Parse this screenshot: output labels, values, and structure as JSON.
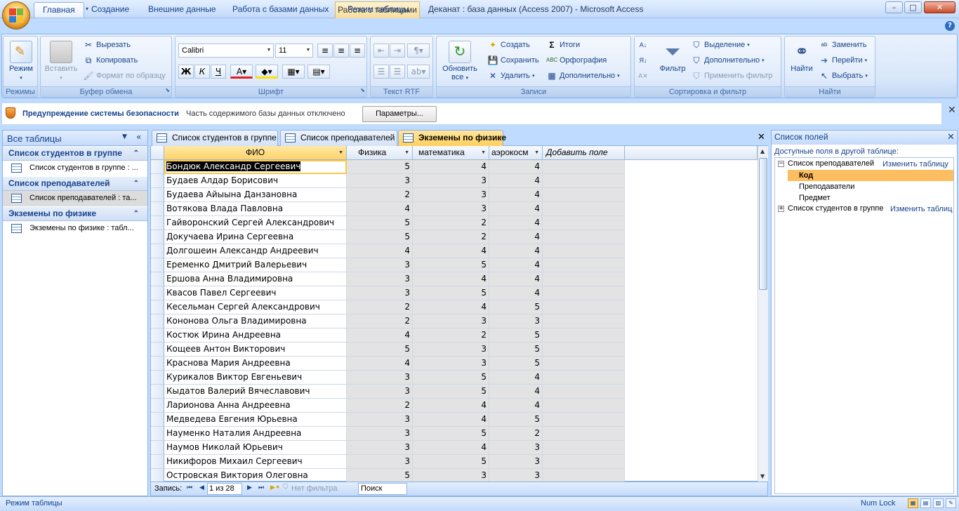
{
  "window": {
    "title": "Деканат : база данных (Access 2007)  -  Microsoft Access",
    "context_tab": "Работа с таблицами",
    "controls": {
      "minimize": "–",
      "maximize": "□",
      "close": "✕"
    },
    "help": "?"
  },
  "ribbon_tabs": [
    "Главная",
    "Создание",
    "Внешние данные",
    "Работа с базами данных",
    "Режим таблицы"
  ],
  "groups": {
    "views": {
      "label": "Режимы",
      "mode": "Режим"
    },
    "clipboard": {
      "label": "Буфер обмена",
      "paste": "Вставить",
      "cut": "Вырезать",
      "copy": "Копировать",
      "format_painter": "Формат по образцу"
    },
    "font": {
      "label": "Шрифт",
      "family": "Calibri",
      "size": "11"
    },
    "rtf": {
      "label": "Текст RTF"
    },
    "records": {
      "label": "Записи",
      "refresh": "Обновить все",
      "new": "Создать",
      "save": "Сохранить",
      "delete": "Удалить",
      "totals": "Итоги",
      "spelling": "Орфография",
      "more": "Дополнительно"
    },
    "sort": {
      "label": "Сортировка и фильтр",
      "filter": "Фильтр",
      "selection": "Выделение",
      "advanced": "Дополнительно",
      "toggle": "Применить фильтр"
    },
    "find": {
      "label": "Найти",
      "find": "Найти",
      "replace": "Заменить",
      "goto": "Перейти",
      "select": "Выбрать"
    }
  },
  "security": {
    "title": "Предупреждение системы безопасности",
    "text": "Часть содержимого базы данных отключено",
    "button": "Параметры..."
  },
  "nav": {
    "title": "Все таблицы",
    "groups": [
      {
        "label": "Список студентов в группе",
        "item": "Список студентов в группе : ..."
      },
      {
        "label": "Список преподавателей",
        "item": "Список преподавателей : та..."
      },
      {
        "label": "Экземены по физике",
        "item": "Экземены по физике : табл..."
      }
    ]
  },
  "doc_tabs": [
    "Список студентов в группе",
    "Список преподавателей",
    "Экземены по физике"
  ],
  "table": {
    "columns": [
      "ФИО",
      "Физика",
      "математика",
      "аэрокосм",
      "Добавить поле"
    ],
    "rows": [
      [
        "Бондюк Александр Сергеевич",
        "5",
        "4",
        "4"
      ],
      [
        "Будаев Алдар Борисович",
        "3",
        "3",
        "4"
      ],
      [
        "Будаева Айыына Данзановна",
        "2",
        "3",
        "4"
      ],
      [
        "Вотякова Влада Павловна",
        "4",
        "3",
        "4"
      ],
      [
        "Гайворонский Сергей Александрович",
        "5",
        "2",
        "4"
      ],
      [
        "Докучаева Ирина Сергеевна",
        "5",
        "2",
        "4"
      ],
      [
        "Долгошеин Александр Андреевич",
        "4",
        "4",
        "4"
      ],
      [
        "Еременко Дмитрий Валерьевич",
        "3",
        "5",
        "4"
      ],
      [
        "Ершова Анна Владимировна",
        "3",
        "4",
        "4"
      ],
      [
        "Квасов Павел Сергеевич",
        "3",
        "5",
        "4"
      ],
      [
        "Кесельман Сергей Александрович",
        "2",
        "4",
        "5"
      ],
      [
        "Кононова Ольга Владимировна",
        "2",
        "3",
        "3"
      ],
      [
        "Костюк Ирина Андреевна",
        "4",
        "2",
        "5"
      ],
      [
        "Кощеев Антон Викторович",
        "5",
        "3",
        "5"
      ],
      [
        "Краснова Мария Андреевна",
        "4",
        "3",
        "5"
      ],
      [
        "Курикалов Виктор Евгеньевич",
        "3",
        "5",
        "4"
      ],
      [
        "Кыдатов Валерий Вячеславович",
        "3",
        "5",
        "4"
      ],
      [
        "Ларионова Анна Андреевна",
        "2",
        "4",
        "4"
      ],
      [
        "Медведева Евгения Юрьевна",
        "3",
        "4",
        "5"
      ],
      [
        "Науменко Наталия Андреевна",
        "3",
        "5",
        "2"
      ],
      [
        "Наумов Николай Юрьевич",
        "3",
        "4",
        "3"
      ],
      [
        "Никифоров Михаил Сергеевич",
        "3",
        "5",
        "3"
      ],
      [
        "Островская Виктория Олеговна",
        "5",
        "3",
        "3"
      ]
    ]
  },
  "record_nav": {
    "label": "Запись:",
    "position": "1 из 28",
    "filter": "Нет фильтра",
    "search": "Поиск"
  },
  "field_list": {
    "title": "Список полей",
    "subtitle": "Доступные поля в другой таблице:",
    "tables": [
      {
        "name": "Список преподавателей",
        "link": "Изменить таблицу",
        "fields": [
          "Код",
          "Преподаватели",
          "Предмет"
        ]
      },
      {
        "name": "Список студентов в группе",
        "link": "Изменить таблиц"
      }
    ]
  },
  "status": {
    "left": "Режим таблицы",
    "num_lock": "Num Lock"
  }
}
